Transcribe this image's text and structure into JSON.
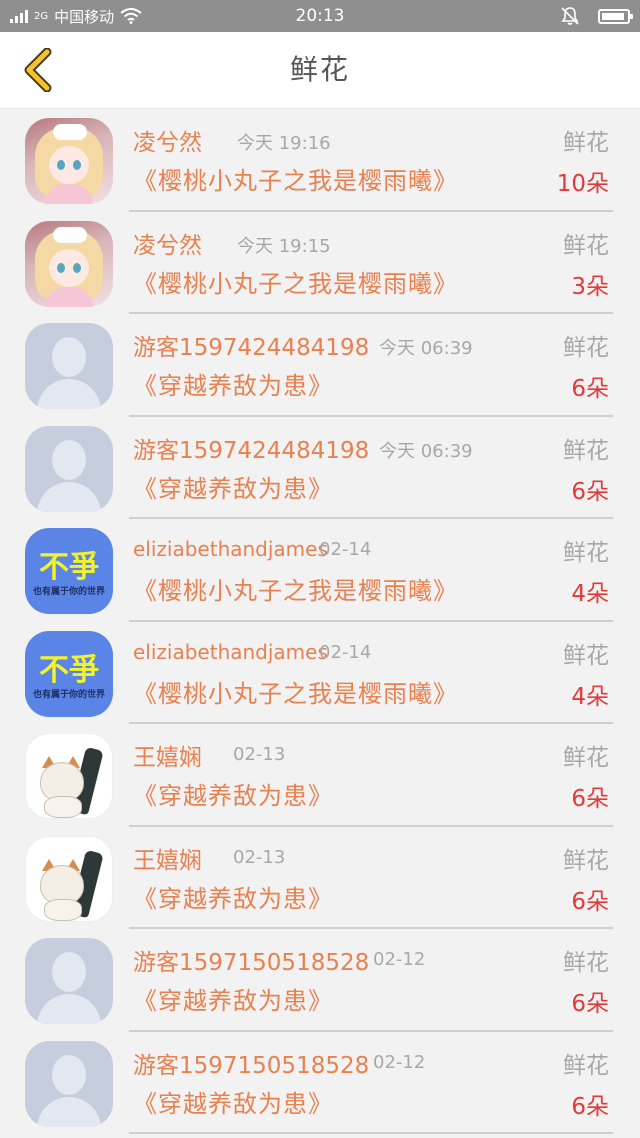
{
  "status_bar": {
    "network": "2G",
    "carrier": "中国移动",
    "time": "20:13"
  },
  "header": {
    "title": "鲜花"
  },
  "gift_label": "鲜花",
  "records": [
    {
      "avatar": "anime-girl",
      "name": "凌兮然",
      "time": "今天 19:16",
      "book": "《樱桃小丸子之我是樱雨曦》",
      "count": "10朵"
    },
    {
      "avatar": "anime-girl",
      "name": "凌兮然",
      "time": "今天 19:15",
      "book": "《樱桃小丸子之我是樱雨曦》",
      "count": "3朵"
    },
    {
      "avatar": "default",
      "name": "游客1597424484198",
      "time": "今天 06:39",
      "book": "《穿越养敌为患》",
      "count": "6朵"
    },
    {
      "avatar": "default",
      "name": "游客1597424484198",
      "time": "今天 06:39",
      "book": "《穿越养敌为患》",
      "count": "6朵"
    },
    {
      "avatar": "buzheng",
      "name": "eliziabethandjames",
      "time": "02-14",
      "book": "《樱桃小丸子之我是樱雨曦》",
      "count": "4朵"
    },
    {
      "avatar": "buzheng",
      "name": "eliziabethandjames",
      "time": "02-14",
      "book": "《樱桃小丸子之我是樱雨曦》",
      "count": "4朵"
    },
    {
      "avatar": "cat",
      "name": "王嬉娴",
      "time": "02-13",
      "book": "《穿越养敌为患》",
      "count": "6朵"
    },
    {
      "avatar": "cat",
      "name": "王嬉娴",
      "time": "02-13",
      "book": "《穿越养敌为患》",
      "count": "6朵"
    },
    {
      "avatar": "default",
      "name": "游客1597150518528",
      "time": "02-12",
      "book": "《穿越养敌为患》",
      "count": "6朵"
    },
    {
      "avatar": "default",
      "name": "游客1597150518528",
      "time": "02-12",
      "book": "《穿越养敌为患》",
      "count": "6朵"
    }
  ],
  "avatar_texts": {
    "buzheng_big": "不爭",
    "buzheng_small": "也有属于你的世界"
  },
  "icons": {
    "back": "chevron-left-icon",
    "wifi": "wifi-icon",
    "mute": "bell-muted-icon",
    "battery": "battery-icon"
  },
  "colors": {
    "accent": "#f4c430",
    "name": "#e8814f",
    "count": "#e23a3a",
    "muted": "#a8a8a8"
  }
}
